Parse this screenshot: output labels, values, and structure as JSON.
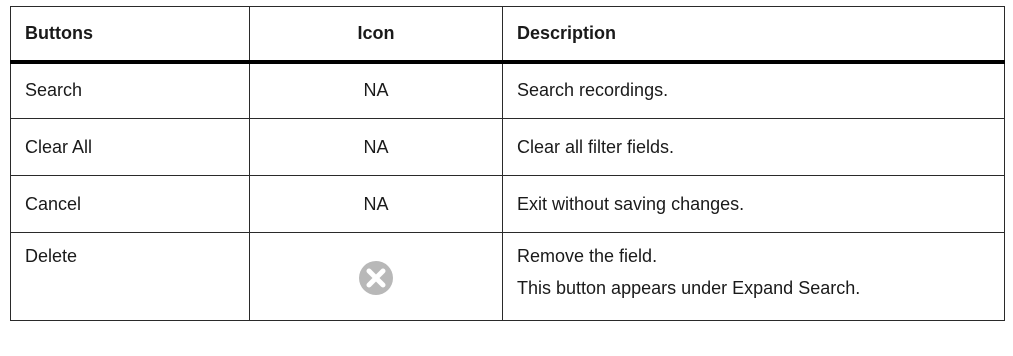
{
  "table": {
    "headers": [
      "Buttons",
      "Icon",
      "Description"
    ],
    "rows": [
      {
        "button": "Search",
        "icon": "NA",
        "description": [
          "Search recordings."
        ]
      },
      {
        "button": "Clear All",
        "icon": "NA",
        "description": [
          "Clear all filter fields."
        ]
      },
      {
        "button": "Cancel",
        "icon": "NA",
        "description": [
          "Exit without saving changes."
        ]
      },
      {
        "button": "Delete",
        "icon_name": "delete-x-icon",
        "description": [
          "Remove the field.",
          "This button appears under Expand Search."
        ]
      }
    ]
  },
  "colors": {
    "border": "#2a2a2a",
    "header_rule": "#000000",
    "icon_gray": "#b8b8b8",
    "text": "#1a1a1a"
  }
}
